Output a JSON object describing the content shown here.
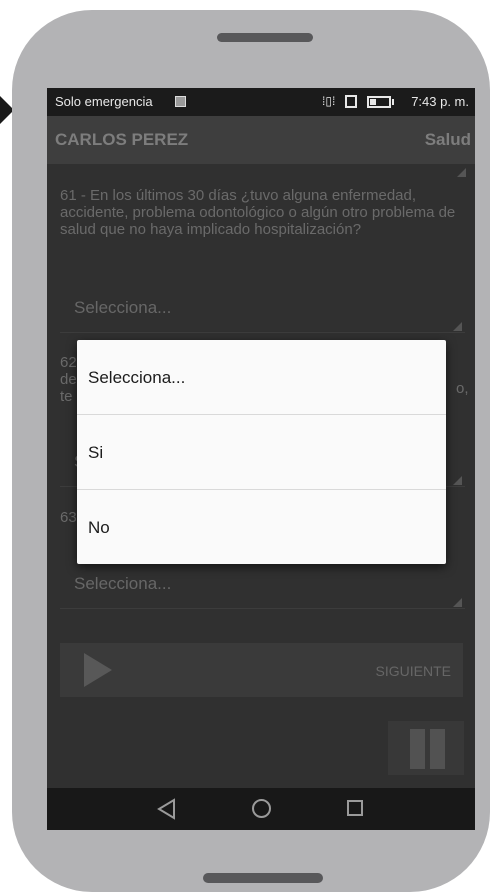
{
  "status_bar": {
    "carrier_text": "Solo emergencia",
    "time": "7:43 p. m.",
    "icons": [
      "notification-icon",
      "vibrate-icon",
      "rotate-icon",
      "battery-icon"
    ]
  },
  "header": {
    "name": "CARLOS PEREZ",
    "section": "Salud"
  },
  "questions": [
    {
      "text": "61 - En los últimos 30 días ¿tuvo alguna enfermedad, accidente, problema odontológico o algún otro problema de salud que no haya implicado hospitalización?",
      "select_value": "Selecciona..."
    },
    {
      "text_prefix": "62",
      "text_line2_start": "de",
      "text_line2_end": "o,",
      "text_line3_start": "te",
      "select_value": "S"
    },
    {
      "text_prefix": "63",
      "select_value": "Selecciona..."
    }
  ],
  "footer": {
    "next_label": "SIGUIENTE"
  },
  "dialog": {
    "options": [
      "Selecciona...",
      "Si",
      "No"
    ]
  },
  "colors": {
    "screen_bg": "#303030",
    "dialog_bg": "#fafafa",
    "phone_body": "#b3b3b5"
  }
}
